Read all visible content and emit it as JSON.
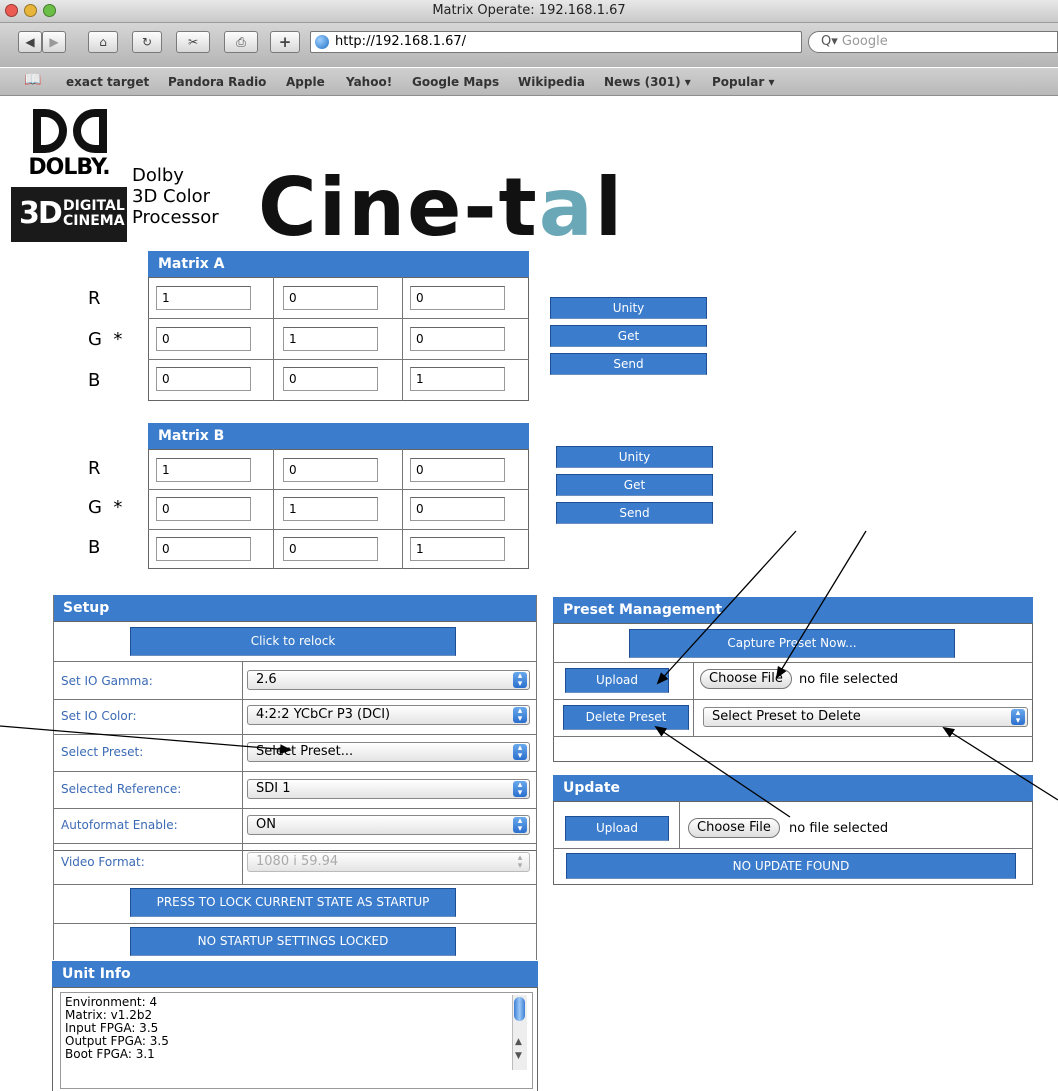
{
  "window": {
    "title": "Matrix Operate: 192.168.1.67"
  },
  "toolbar": {
    "url": "http://192.168.1.67/",
    "search_placeholder": "Google",
    "plus": "+"
  },
  "bookmarks": [
    "exact target",
    "Pandora Radio",
    "Apple",
    "Yahoo!",
    "Google Maps",
    "Wikipedia",
    "News (301) ▾",
    "Popular ▾"
  ],
  "logo": {
    "dolby_word": "DOLBY.",
    "dolby_3d": "3D",
    "dolby_digital": "DIGITAL",
    "dolby_cinema": "CINEMA",
    "product_line1": "Dolby",
    "product_line2": "3D Color",
    "product_line3": "Processor",
    "brand_prefix": "Cine-t",
    "brand_accent": "a",
    "brand_suffix": "l"
  },
  "matrix_a": {
    "title": "Matrix A",
    "rows": [
      {
        "label": "R",
        "values": [
          "1",
          "0",
          "0"
        ]
      },
      {
        "label": "G  *",
        "values": [
          "0",
          "1",
          "0"
        ]
      },
      {
        "label": "B",
        "values": [
          "0",
          "0",
          "1"
        ]
      }
    ],
    "buttons": {
      "unity": "Unity",
      "get": "Get",
      "send": "Send"
    }
  },
  "matrix_b": {
    "title": "Matrix B",
    "rows": [
      {
        "label": "R",
        "values": [
          "1",
          "0",
          "0"
        ]
      },
      {
        "label": "G  *",
        "values": [
          "0",
          "1",
          "0"
        ]
      },
      {
        "label": "B",
        "values": [
          "0",
          "0",
          "1"
        ]
      }
    ],
    "buttons": {
      "unity": "Unity",
      "get": "Get",
      "send": "Send"
    }
  },
  "setup": {
    "title": "Setup",
    "relock": "Click to relock",
    "fields": [
      {
        "label": "Set IO Gamma:",
        "value": "2.6"
      },
      {
        "label": "Set IO Color:",
        "value": "4:2:2 YCbCr P3 (DCI)"
      },
      {
        "label": "Select Preset:",
        "value": "Select Preset..."
      },
      {
        "label": "Selected Reference:",
        "value": "SDI 1"
      },
      {
        "label": "Autoformat Enable:",
        "value": "ON"
      },
      {
        "label": "Video Format:",
        "value": "1080 i 59.94"
      }
    ],
    "lock_button": "PRESS TO LOCK CURRENT STATE AS STARTUP",
    "startup_status": "NO STARTUP SETTINGS LOCKED"
  },
  "unit_info": {
    "title": "Unit Info",
    "lines": "Environment: 4\nMatrix: v1.2b2\nInput FPGA: 3.5\nOutput FPGA: 3.5\nBoot FPGA: 3.1"
  },
  "preset_management": {
    "title": "Preset Management",
    "capture": "Capture Preset Now...",
    "upload": "Upload",
    "choose_file": "Choose File",
    "no_file": "no file selected",
    "delete": "Delete Preset",
    "delete_select": "Select Preset to Delete"
  },
  "update": {
    "title": "Update",
    "upload": "Upload",
    "choose_file": "Choose File",
    "no_file": "no file selected",
    "status": "NO UPDATE FOUND"
  },
  "colors": {
    "accent": "#3b7ccc",
    "label_blue": "#3b6ab5"
  }
}
